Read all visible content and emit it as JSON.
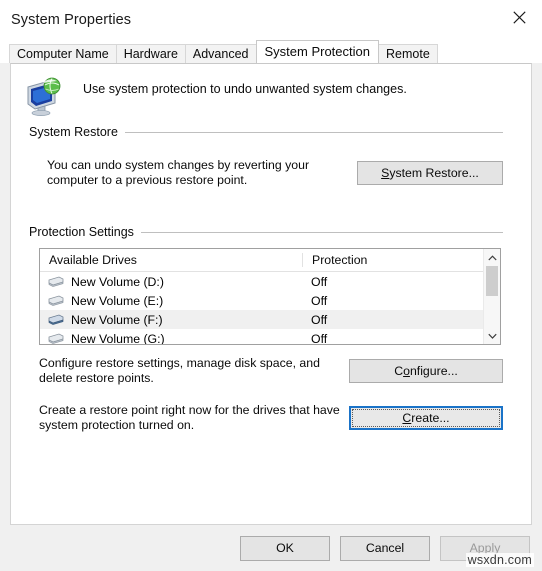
{
  "window": {
    "title": "System Properties",
    "close_icon": "close-icon"
  },
  "tabs": [
    {
      "label": "Computer Name",
      "selected": false
    },
    {
      "label": "Hardware",
      "selected": false
    },
    {
      "label": "Advanced",
      "selected": false
    },
    {
      "label": "System Protection",
      "selected": true
    },
    {
      "label": "Remote",
      "selected": false
    }
  ],
  "page": {
    "icon_name": "system-protection-icon",
    "headline": "Use system protection to undo unwanted system changes."
  },
  "system_restore": {
    "group_title": "System Restore",
    "description": "You can undo system changes by reverting your computer to a previous restore point.",
    "button": {
      "prefix": "",
      "accel": "S",
      "suffix": "ystem Restore..."
    }
  },
  "protection_settings": {
    "group_title": "Protection Settings",
    "columns": [
      "Available Drives",
      "Protection"
    ],
    "rows": [
      {
        "drive": "New Volume (D:)",
        "protection": "Off",
        "selected": false
      },
      {
        "drive": "New Volume (E:)",
        "protection": "Off",
        "selected": false
      },
      {
        "drive": "New Volume (F:)",
        "protection": "Off",
        "selected": true
      },
      {
        "drive": "New Volume (G:)",
        "protection": "Off",
        "selected": false
      }
    ],
    "scroll": {
      "up_icon": "chevron-up-icon",
      "down_icon": "chevron-down-icon"
    },
    "configure": {
      "description": "Configure restore settings, manage disk space, and delete restore points.",
      "button": {
        "prefix": "C",
        "accel": "o",
        "suffix": "nfigure..."
      }
    },
    "create": {
      "description": "Create a restore point right now for the drives that have system protection turned on.",
      "button": {
        "prefix": "",
        "accel": "C",
        "suffix": "reate..."
      }
    }
  },
  "footer": {
    "ok": "OK",
    "cancel": "Cancel",
    "apply": "Apply"
  },
  "watermark": "wsxdn.com",
  "colors": {
    "dialog_bg": "#f0f0f0",
    "page_bg": "#ffffff",
    "focus_border": "#1a73c8",
    "selected_row": "#f0f0f0",
    "scroll_thumb": "#cdcdcd"
  }
}
